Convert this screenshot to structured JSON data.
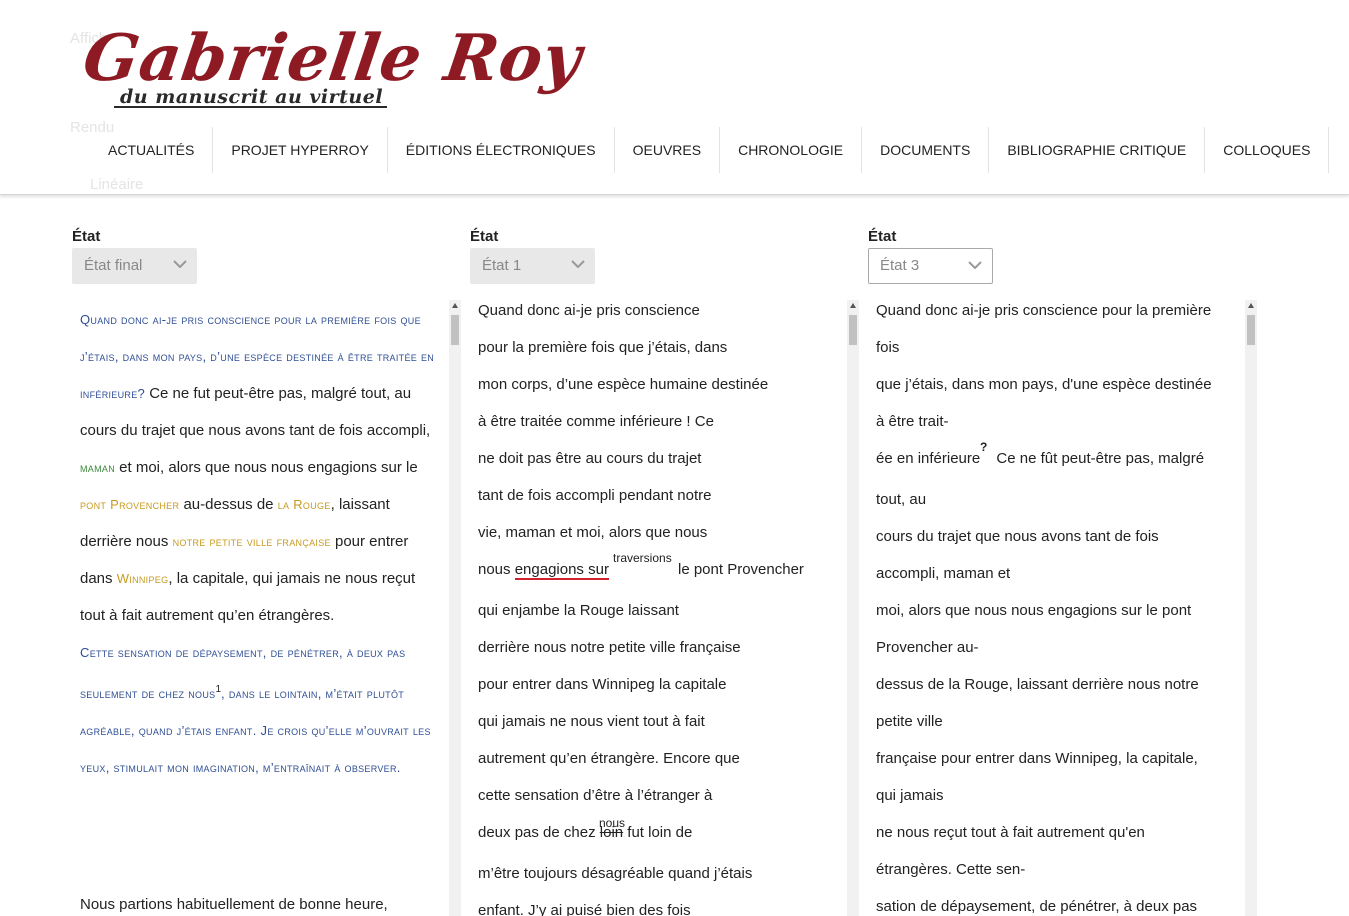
{
  "header": {
    "logo_title": "Gabrielle Roy",
    "logo_tagline": "du manuscrit au virtuel",
    "nav": [
      "ACTUALITÉS",
      "PROJET HYPERROY",
      "ÉDITIONS ÉLECTRONIQUES",
      "OEUVRES",
      "CHRONOLOGIE",
      "DOCUMENTS",
      "BIBLIOGRAPHIE CRITIQUE",
      "COLLOQUES"
    ]
  },
  "ghost_sidebar": {
    "afficher": "Affich",
    "rendu": "Rendu",
    "lineaire": "Linéaire"
  },
  "columns": [
    {
      "label": "État",
      "select_value": "État final"
    },
    {
      "label": "État",
      "select_value": "État 1"
    },
    {
      "label": "État",
      "select_value": "État 3"
    }
  ],
  "col1": {
    "p1_a": "Quand donc ai-je pris conscience pour la première fois que j’étais, dans mon pays, d’une espèce destinée à être traitée en inférieure?",
    "p1_b": " Ce ne fut peut-être pas, malgré tout, au cours du trajet que nous avons tant de fois accompli, ",
    "maman": "maman",
    "p1_c": " et moi, alors que nous nous engagions sur le ",
    "pont": "pont Provencher",
    "p1_d": " au-dessus de ",
    "rouge": "la Rouge",
    "p1_e": ", laissant derrière nous ",
    "ville": "notre petite ville française",
    "p1_f": " pour entrer dans ",
    "winnipeg": "Winnipeg",
    "p1_g": ", la capitale, qui jamais ne nous reçut tout à fait autrement qu’en étrangères.",
    "p2_a": "Cette sensation de dépaysement, de pénétrer, à deux pas seulement de chez nous",
    "footnote": "1",
    "p2_b": ", dans le lointain, m’était plutôt agréable, quand j’étais enfant. Je crois qu’elle m’ouvrait les yeux, stimulait mon imagination, m’entraînait à observer.",
    "p3": "Nous partions habituellement de bonne heure,"
  },
  "col2": {
    "l1": "Quand donc ai-je pris conscience",
    "l2": "pour la première fois que j’étais, dans",
    "l3": "mon corps, d’une espèce humaine destinée",
    "l4": "à être traitée comme inférieure ! Ce",
    "l5": "ne doit pas être au cours du trajet",
    "l6": "tant de fois accompli pendant notre",
    "l7": "vie, maman et moi, alors que nous",
    "l8_a": "nous ",
    "l8_b": "engagions sur",
    "l8_sup": "traversions",
    "l8_c": "le pont Provencher",
    "l9": "qui enjambe la Rouge laissant",
    "l10": "derrière nous notre petite ville française",
    "l11": "pour entrer dans Winnipeg la capitale",
    "l12": "qui jamais ne nous vient tout à fait",
    "l13": "autrement qu’en étrangère. Encore que",
    "l14": "cette sensation d’être à l’étranger à",
    "l15_a": "deux pas de chez ",
    "l15_sup": "nous",
    "l15_b": "loin",
    "l15_c": " fut loin de",
    "l16": "m’être toujours désagréable quand j’étais",
    "l17": "enfant. J’y ai puisé bien des fois"
  },
  "col3": {
    "l1": "Quand donc ai-je pris conscience pour la première",
    "l2": "fois",
    "l3": "que j’étais, dans mon pays, d'une espèce destinée",
    "l4": "à être trait-",
    "l5_a": "ée en inférieure",
    "l5_sup": "?",
    "l5_b": " Ce ne fût peut-être pas, malgré",
    "l6": "tout, au",
    "l7": "cours du trajet que nous avons tant de fois",
    "l8": "accompli, maman et",
    "l9": "moi, alors que nous nous engagions sur le pont",
    "l10": "Provencher au-",
    "l11": "dessus de la Rouge, laissant derrière nous notre",
    "l12": "petite ville",
    "l13": "française pour entrer dans Winnipeg, la capitale,",
    "l14": "qui jamais",
    "l15": "ne nous reçut tout à fait autrement qu'en",
    "l16": "étrangères. Cette sen-",
    "l17": "sation de dépaysement, de pénétrer, à deux pas"
  }
}
